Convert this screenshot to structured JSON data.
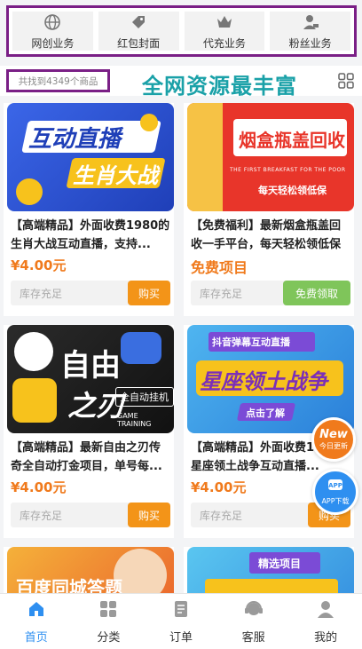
{
  "categories": [
    {
      "label": "网创业务",
      "icon": "globe-icon"
    },
    {
      "label": "红包封面",
      "icon": "tag-icon"
    },
    {
      "label": "代充业务",
      "icon": "crown-icon"
    },
    {
      "label": "粉丝业务",
      "icon": "user-icon"
    }
  ],
  "search": {
    "found_text": "共找到4349个商品",
    "slogan": "全网资源最丰富"
  },
  "products": [
    {
      "title": "【高端精品】外面收费1980的生肖大战互动直播，支持...",
      "price": "¥4.00元",
      "stock": "库存充足",
      "action": "购买",
      "banner": {
        "line1": "互动直播",
        "line2": "生肖大战"
      }
    },
    {
      "title": "【免费福利】最新烟盒瓶盖回收一手平台，每天轻松领低保",
      "price": "免费项目",
      "stock": "库存充足",
      "action": "免费领取",
      "banner": {
        "line1": "烟盒瓶盖回收",
        "line2": "THE FIRST BREAKFAST FOR THE POOR",
        "line3": "每天轻松领低保"
      }
    },
    {
      "title": "【高端精品】最新自由之刃传奇全自动打金项目，单号每...",
      "price": "¥4.00元",
      "stock": "库存充足",
      "action": "购买",
      "banner": {
        "line1": "自由",
        "line2": "之刃",
        "line3": "全自动挂机",
        "line4": "GAME TRAINING"
      }
    },
    {
      "title": "【高端精品】外面收费1980的星座领土战争互动直播...",
      "price": "¥4.00元",
      "stock": "库存充足",
      "action": "购买",
      "banner": {
        "line1": "抖音弹幕互动直播",
        "line2": "星座领土战争",
        "line3": "点击了解"
      }
    },
    {
      "title": "",
      "price": "",
      "stock": "",
      "action": "",
      "banner": {
        "line1": "百度同城答题"
      }
    },
    {
      "title": "",
      "price": "",
      "stock": "",
      "action": "",
      "banner": {
        "line1": "精选项目"
      }
    }
  ],
  "floating": {
    "new_label": "New",
    "new_sub": "今日更新",
    "app_label": "APP下载"
  },
  "tabs": [
    {
      "label": "首页",
      "icon": "home-icon"
    },
    {
      "label": "分类",
      "icon": "category-icon"
    },
    {
      "label": "订单",
      "icon": "order-icon"
    },
    {
      "label": "客服",
      "icon": "service-icon"
    },
    {
      "label": "我的",
      "icon": "profile-icon"
    }
  ],
  "colors": {
    "accent": "#2e8ff0",
    "price": "#f07a1c",
    "buy": "#f39418",
    "free": "#7fc55a",
    "highlight_border": "#7a1f86",
    "slogan": "#1aa1a8"
  }
}
